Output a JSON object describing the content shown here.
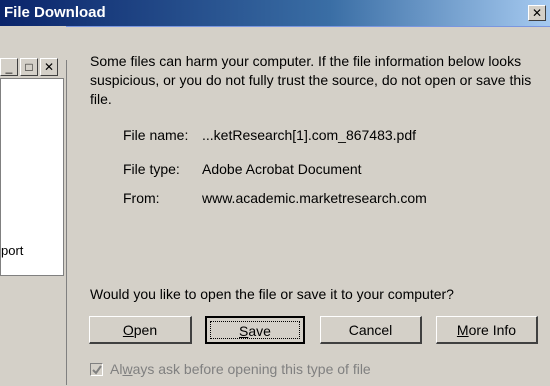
{
  "title": "File Download",
  "close_glyph": "✕",
  "background_window": {
    "minimize_glyph": "_",
    "maximize_glyph": "□",
    "close_glyph": "✕",
    "partial_text": "port"
  },
  "message": "Some files can harm your computer. If the file information below looks suspicious, or you do not fully trust the source, do not open or save this file.",
  "file_info": [
    {
      "label": "File name:",
      "value": "...ketResearch[1].com_867483.pdf"
    },
    {
      "label": "File type:",
      "value": "Adobe Acrobat Document"
    },
    {
      "label": "From:",
      "value": "www.academic.marketresearch.com"
    }
  ],
  "question": "Would you like to open the file or save it to your computer?",
  "buttons": {
    "open": {
      "mnemonic": "O",
      "rest": "pen"
    },
    "save": {
      "mnemonic": "S",
      "rest": "ave"
    },
    "cancel": "Cancel",
    "more_info": {
      "mnemonic": "M",
      "rest": "ore Info"
    }
  },
  "checkbox": {
    "label_prefix": "Al",
    "mnemonic": "w",
    "label_rest": "ays ask before opening this type of file",
    "checked": true
  }
}
